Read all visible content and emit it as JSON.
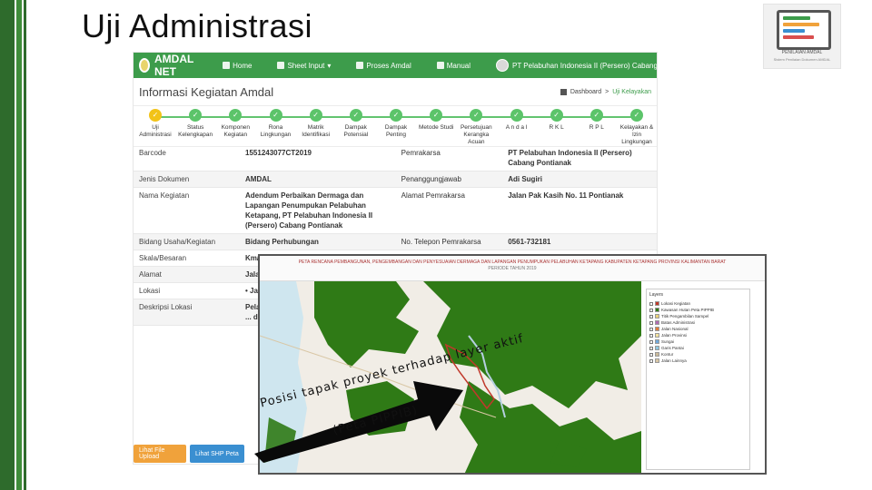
{
  "slide": {
    "title": "Uji Administrasi",
    "logo_caption": "PENILAIAN AMDAL",
    "logo_subcaption": "Sistem Penilaian Dokumen AMDAL"
  },
  "app": {
    "brand": "AMDAL NET",
    "nav": [
      "Home",
      "Sheet Input",
      "Proses Amdal",
      "Manual"
    ],
    "user": "PT Pelabuhan Indonesia II (Persero) Cabang Pontianak",
    "page_title": "Informasi Kegiatan Amdal",
    "breadcrumb_home": "Dashboard",
    "breadcrumb_current": "Uji Kelayakan",
    "steps": [
      "Uji Administrasi",
      "Status Kelengkapan",
      "Komponen Kegiatan",
      "Rona Lingkungan",
      "Matrik Identifikasi",
      "Dampak Potensial",
      "Dampak Penting",
      "Metode Studi",
      "Persetujuan Kerangka Acuan",
      "A n d a l",
      "R K L",
      "R P L",
      "Kelayakan & Izin Lingkungan"
    ],
    "rows": [
      {
        "l1": "Barcode",
        "v1": "1551243077CT2019",
        "l2": "Pemrakarsa",
        "v2": "PT Pelabuhan Indonesia II (Persero) Cabang Pontianak"
      },
      {
        "l1": "Jenis Dokumen",
        "v1": "AMDAL",
        "l2": "Penanggungjawab",
        "v2": "Adi Sugiri"
      },
      {
        "l1": "Nama Kegiatan",
        "v1": "Adendum Perbaikan Dermaga dan Lapangan Penumpukan Pelabuhan Ketapang, PT Pelabuhan Indonesia II (Persero) Cabang Pontianak",
        "l2": "Alamat Pemrakarsa",
        "v2": "Jalan Pak Kasih No. 11 Pontianak"
      },
      {
        "l1": "Bidang Usaha/Kegiatan",
        "v1": "Bidang Perhubungan",
        "l2": "No. Telepon Pemrakarsa",
        "v2": "0561-732181"
      },
      {
        "l1": "Skala/Besaran",
        "v1": "Km/m",
        "l2": "",
        "v2": ""
      },
      {
        "l1": "Alamat",
        "v1": "Jalan ... Kecamatan ... Ketapang",
        "l2": "",
        "v2": ""
      },
      {
        "l1": "Lokasi",
        "v1": "• Jalan ... Kecamatan ... Indonesia",
        "l2": "",
        "v2": ""
      },
      {
        "l1": "Deskripsi Lokasi",
        "v1": "Pelabuhan ... beradi ... Delta ... Pelabuhan ... dokumen",
        "l2": "",
        "v2": ""
      }
    ],
    "btn_upload": "Lihat File Upload",
    "btn_peta": "Lihat SHP Peta"
  },
  "map": {
    "header": "PETA RENCANA PEMBANGUNAN, PENGEMBANGAN DAN PENYESUAIAN DERMAGA DAN LAPANGAN PENUMPUKAN PELABUHAN KETAPANG KABUPATEN KETAPANG PROVINSI KALIMANTAN BARAT",
    "subheader": "PERIODE TAHUN 2019",
    "legend_title": "Layers",
    "legend_items": [
      "Lokasi Kegiatan",
      "Kawasan Hutan Peta PIPPIB",
      "Titik Pengambilan Sampel",
      "Batas Administrasi",
      "Jalan Nasional",
      "Jalan Provinsi",
      "Sungai",
      "Garis Pantai",
      "Kontur",
      "Jalan Lainnya"
    ],
    "colors": {
      "forest": "#2f7a16",
      "project": "#c0392b",
      "base": "#f1ede6",
      "sea": "#cfe6ef"
    }
  },
  "annotation": {
    "line1": "Posisi tapak proyek terhadap layer aktif",
    "line2": "(Peta PIPPIB)"
  }
}
